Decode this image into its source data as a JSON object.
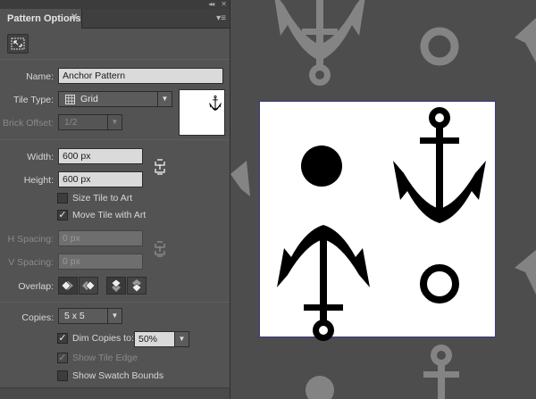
{
  "panel": {
    "tab_title": "Pattern Options",
    "collapse_glyph": "◂◂",
    "close_glyph": "✕",
    "tab_close_glyph": "✕",
    "menu_glyph": "▾≡",
    "tool_icon": "tile-editor-icon"
  },
  "form": {
    "name_label": "Name:",
    "name_value": "Anchor Pattern",
    "tile_type_label": "Tile Type:",
    "tile_type_value": "Grid",
    "brick_offset_label": "Brick Offset:",
    "brick_offset_value": "1/2",
    "width_label": "Width:",
    "width_value": "600 px",
    "height_label": "Height:",
    "height_value": "600 px",
    "size_tile_label": "Size Tile to Art",
    "size_tile_checked": false,
    "move_tile_label": "Move Tile with Art",
    "move_tile_checked": true,
    "h_spacing_label": "H Spacing:",
    "h_spacing_value": "0 px",
    "v_spacing_label": "V Spacing:",
    "v_spacing_value": "0 px",
    "overlap_label": "Overlap:",
    "copies_label": "Copies:",
    "copies_value": "5 x 5",
    "dim_copies_label": "Dim Copies to:",
    "dim_copies_checked": true,
    "dim_copies_value": "50%",
    "show_tile_edge_label": "Show Tile Edge",
    "show_tile_edge_checked": true,
    "show_swatch_bounds_label": "Show Swatch Bounds",
    "show_swatch_bounds_checked": false
  },
  "colors": {
    "panel_bg": "#535353",
    "canvas_bg": "#4d4d4d",
    "ghost_art": "#8a8a8a",
    "tile_border": "#3a3a8a"
  }
}
